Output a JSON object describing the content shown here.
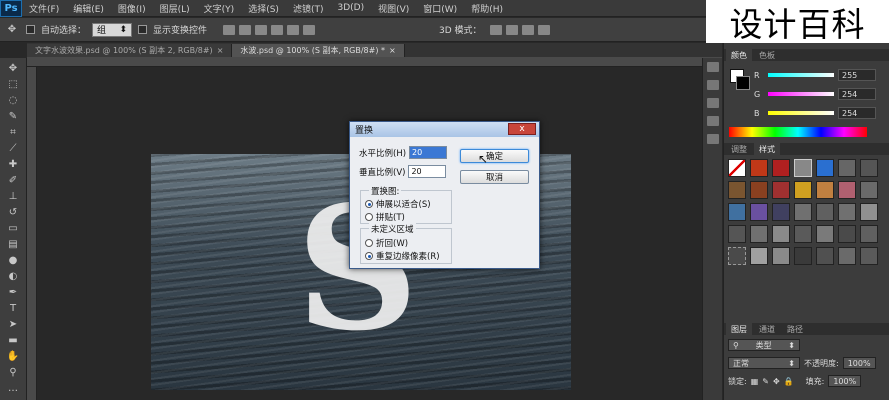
{
  "app": {
    "logo": "Ps"
  },
  "menubar": {
    "items": [
      "文件(F)",
      "编辑(E)",
      "图像(I)",
      "图层(L)",
      "文字(Y)",
      "选择(S)",
      "滤镜(T)",
      "3D(D)",
      "视图(V)",
      "窗口(W)",
      "帮助(H)"
    ]
  },
  "options": {
    "auto_select_label": "自动选择：",
    "auto_select_value": "组",
    "show_transform_label": "显示变换控件",
    "mode_label": "3D 模式："
  },
  "tabs": [
    {
      "label": "文字水波效果.psd @ 100% (S 副本 2, RGB/8#)",
      "close": "×"
    },
    {
      "label": "水波.psd @ 100% (S 副本, RGB/8#) *",
      "close": "×"
    }
  ],
  "document": {
    "letter": "S"
  },
  "dialog": {
    "title": "置换",
    "close": "x",
    "h_scale_label": "水平比例(H)",
    "h_scale_value": "20",
    "v_scale_label": "垂直比例(V)",
    "v_scale_value": "20",
    "ok_label": "确定",
    "cancel_label": "取消",
    "map_group_title": "置换图:",
    "map_options": [
      "伸展以适合(S)",
      "拼贴(T)"
    ],
    "undef_group_title": "未定义区域",
    "undef_options": [
      "折回(W)",
      "重复边缘像素(R)"
    ]
  },
  "right_panel": {
    "tabs": [
      "颜色",
      "色板"
    ],
    "styles_tabs": [
      "调整",
      "样式"
    ],
    "channels": [
      {
        "label": "R",
        "value": "255",
        "gradient": "#ffffff"
      },
      {
        "label": "G",
        "value": "254",
        "gradient": "#ff00ff"
      },
      {
        "label": "B",
        "value": "254",
        "gradient": "#ffff00"
      }
    ],
    "layers_tabs": [
      "图层",
      "通道",
      "路径"
    ],
    "layers": {
      "kind_label": "类型",
      "blend_mode": "正常",
      "opacity_label": "不透明度:",
      "opacity_value": "100%",
      "lock_label": "锁定:",
      "fill_label": "填充:",
      "fill_value": "100%"
    }
  },
  "watermark": {
    "text": "设计百科"
  },
  "colors": {
    "accent": "#3c8ad8"
  }
}
